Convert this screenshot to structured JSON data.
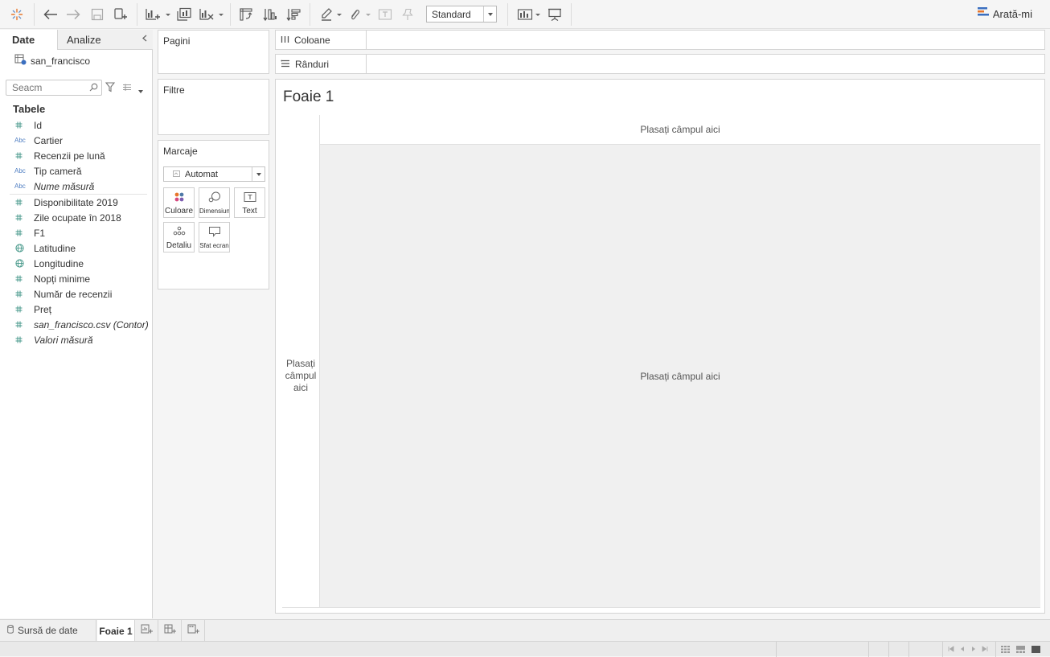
{
  "toolbar": {
    "layout_select_value": "Standard",
    "show_me_label": "Arată-mi"
  },
  "data_pane": {
    "tab_data": "Date",
    "tab_analytics": "Analize",
    "datasource_name": "san_francisco",
    "search_placeholder": "Seacm",
    "tables_heading": "Tabele",
    "fields_group1": [
      {
        "icon": "#",
        "label": "Id",
        "italic": false
      },
      {
        "icon": "Abc",
        "label": "Cartier",
        "italic": false
      },
      {
        "icon": "#",
        "label": "Recenzii pe lună",
        "italic": false
      },
      {
        "icon": "Abc",
        "label": "Tip cameră",
        "italic": false
      },
      {
        "icon": "Abc",
        "label": "Nume măsură",
        "italic": true
      }
    ],
    "fields_group2": [
      {
        "icon": "#",
        "label": "Disponibilitate 2019",
        "italic": false
      },
      {
        "icon": "#",
        "label": "Zile ocupate în 2018",
        "italic": false
      },
      {
        "icon": "#",
        "label": "F1",
        "italic": false
      },
      {
        "icon": "globe",
        "label": "Latitudine",
        "italic": false
      },
      {
        "icon": "globe",
        "label": "Longitudine",
        "italic": false
      },
      {
        "icon": "#",
        "label": "Nopți minime",
        "italic": false
      },
      {
        "icon": "#",
        "label": "Număr de recenzii",
        "italic": false
      },
      {
        "icon": "#",
        "label": "Preț",
        "italic": false
      },
      {
        "icon": "#",
        "label": "san_francisco.csv (Contor)",
        "italic": true
      },
      {
        "icon": "#",
        "label": "Valori măsură",
        "italic": true
      }
    ]
  },
  "shelves": {
    "pages_title": "Pagini",
    "filters_title": "Filtre",
    "marks_title": "Marcaje",
    "marks_type": "Automat",
    "marks_buttons": {
      "color": "Culoare",
      "size": "Dimensiuna",
      "text": "Text",
      "detail": "Detaliu",
      "tooltip": "Sfat ecran"
    },
    "columns_label": "Coloane",
    "rows_label": "Rânduri"
  },
  "worksheet": {
    "title": "Foaie 1",
    "drop_columns": "Plasați câmpul aici",
    "drop_rows": "Plasați câmpul aici",
    "drop_main": "Plasați câmpul aici"
  },
  "bottom_tabs": {
    "datasource_tab": "Sursă de date",
    "sheet_tab": "Foaie 1"
  },
  "colors": {
    "measure_icon": "#4a9a8c",
    "dimension_icon": "#4f7ec2",
    "show_me_accent": "#3b6fc0"
  }
}
